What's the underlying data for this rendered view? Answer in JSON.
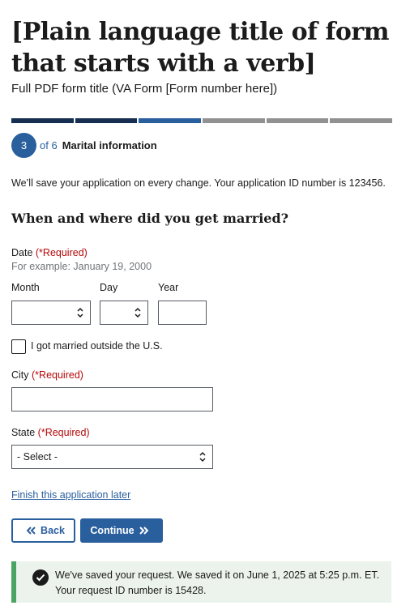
{
  "header": {
    "title": "[Plain language title of form that starts with a verb]",
    "subtitle": "Full PDF form title (VA Form [Form number here])"
  },
  "progress": {
    "current_step": "3",
    "total_text": "of 6",
    "step_label": "Marital information",
    "segments_total": 6,
    "segments_completed": 2,
    "colors": {
      "done": "#162e51",
      "current": "#2a5f9e",
      "todo": "#919191"
    }
  },
  "save_note": "We’ll save your application on every change. Your application ID number is 123456.",
  "question": "When and where did you get married?",
  "date": {
    "label": "Date",
    "required": "(*Required)",
    "hint": "For example: January 19, 2000",
    "month_label": "Month",
    "day_label": "Day",
    "year_label": "Year",
    "month_value": "",
    "day_value": "",
    "year_value": ""
  },
  "outside_us": {
    "label": "I got married outside the U.S.",
    "checked": false
  },
  "city": {
    "label": "City",
    "required": "(*Required)",
    "value": ""
  },
  "state": {
    "label": "State",
    "required": "(*Required)",
    "selected": "- Select -"
  },
  "finish_later": "Finish this application later",
  "buttons": {
    "back": "Back",
    "continue": "Continue"
  },
  "alert": {
    "line1": "We've saved your request. We saved it on June 1, 2025 at 5:25 p.m. ET.",
    "line2": "Your request ID number is 15428.",
    "accent_color": "#4aa564"
  }
}
